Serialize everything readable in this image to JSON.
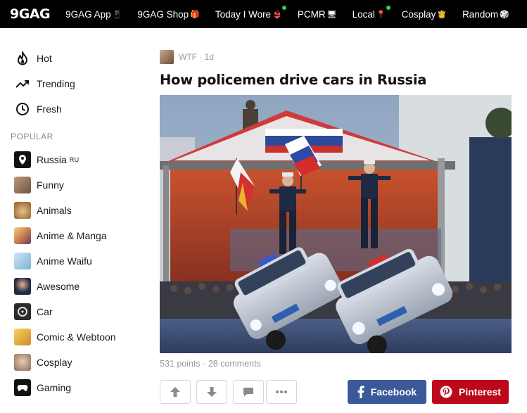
{
  "topbar": {
    "logo": "9GAG",
    "nav": [
      {
        "label": "9GAG App",
        "emoji": "📱"
      },
      {
        "label": "9GAG Shop",
        "emoji": "🎁"
      },
      {
        "label": "Today I Wore",
        "emoji": "👙"
      },
      {
        "label": "PCMR",
        "emoji": "🖥"
      },
      {
        "label": "Local",
        "emoji": "📍"
      },
      {
        "label": "Cosplay",
        "emoji": "👸"
      },
      {
        "label": "Random",
        "emoji": "🎲"
      }
    ]
  },
  "sidebar": {
    "main": [
      {
        "label": "Hot",
        "icon": "flame-icon"
      },
      {
        "label": "Trending",
        "icon": "trending-icon"
      },
      {
        "label": "Fresh",
        "icon": "clock-icon"
      }
    ],
    "popular_heading": "POPULAR",
    "sections": [
      {
        "label": "Russia",
        "sup": "RU",
        "thumb_color": "#111111"
      },
      {
        "label": "Funny",
        "thumb_color": "#9c7b62"
      },
      {
        "label": "Animals",
        "thumb_color": "#b07a3c"
      },
      {
        "label": "Anime & Manga",
        "thumb_color": "#d9a85a"
      },
      {
        "label": "Anime Waifu",
        "thumb_color": "#8fb8d8"
      },
      {
        "label": "Awesome",
        "thumb_color": "#1f2a44"
      },
      {
        "label": "Car",
        "thumb_color": "#2b2b2b"
      },
      {
        "label": "Comic & Webtoon",
        "thumb_color": "#e0b83c"
      },
      {
        "label": "Cosplay",
        "thumb_color": "#c9a48a"
      },
      {
        "label": "Gaming",
        "thumb_color": "#111111"
      }
    ]
  },
  "post": {
    "section": "WTF",
    "age": "1d",
    "title": "How policemen drive cars in Russia",
    "points": "531 points",
    "comments": "28 comments",
    "facebook_label": "Facebook",
    "pinterest_label": "Pinterest"
  },
  "colors": {
    "facebook": "#3b5998",
    "pinterest": "#bd081c",
    "topbar": "#000000"
  }
}
